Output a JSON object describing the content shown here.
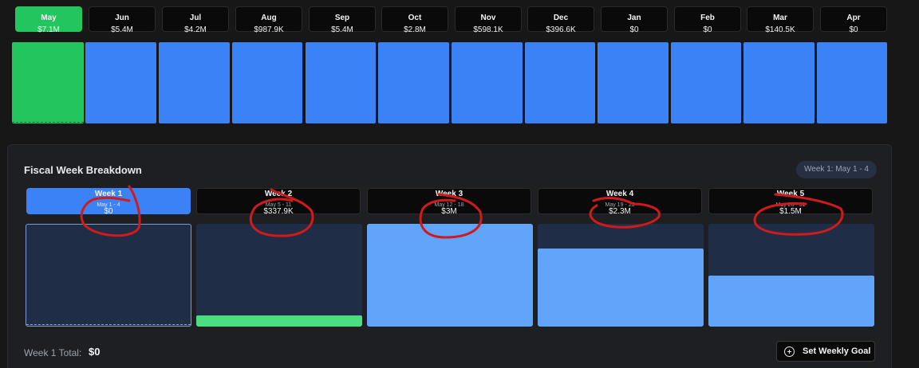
{
  "months": [
    {
      "name": "May",
      "value": "$7.1M",
      "active": true
    },
    {
      "name": "Jun",
      "value": "$5.4M"
    },
    {
      "name": "Jul",
      "value": "$4.2M"
    },
    {
      "name": "Aug",
      "value": "$987.9K"
    },
    {
      "name": "Sep",
      "value": "$5.4M"
    },
    {
      "name": "Oct",
      "value": "$2.8M"
    },
    {
      "name": "Nov",
      "value": "$598.1K"
    },
    {
      "name": "Dec",
      "value": "$396.6K"
    },
    {
      "name": "Jan",
      "value": "$0"
    },
    {
      "name": "Feb",
      "value": "$0"
    },
    {
      "name": "Mar",
      "value": "$140.5K"
    },
    {
      "name": "Apr",
      "value": "$0"
    }
  ],
  "week_panel": {
    "title": "Fiscal Week Breakdown",
    "selected_badge": "Week 1: May 1 - 4",
    "weeks": [
      {
        "name": "Week 1",
        "range": "May 1 - 4",
        "value": "$0",
        "active": true,
        "fill": 0
      },
      {
        "name": "Week 2",
        "range": "May 5 - 11",
        "value": "$337.9K",
        "fill": 0.11
      },
      {
        "name": "Week 3",
        "range": "May 12 - 18",
        "value": "$3M",
        "fill": 1.0
      },
      {
        "name": "Week 4",
        "range": "May 19 - 25",
        "value": "$2.3M",
        "fill": 0.76
      },
      {
        "name": "Week 5",
        "range": "May 26 - 31",
        "value": "$1.5M",
        "fill": 0.5
      }
    ],
    "total_label": "Week 1 Total:",
    "total_value": "$0",
    "set_goal_label": "Set Weekly Goal"
  },
  "colors": {
    "accent_green": "#22c55e",
    "accent_blue": "#3b82f6",
    "week_fill_blue": "#60a5fa",
    "week_fill_green": "#4ade80",
    "annotation_red": "#d11a1a"
  },
  "icons": {
    "set_goal": "plus-circle-icon"
  }
}
